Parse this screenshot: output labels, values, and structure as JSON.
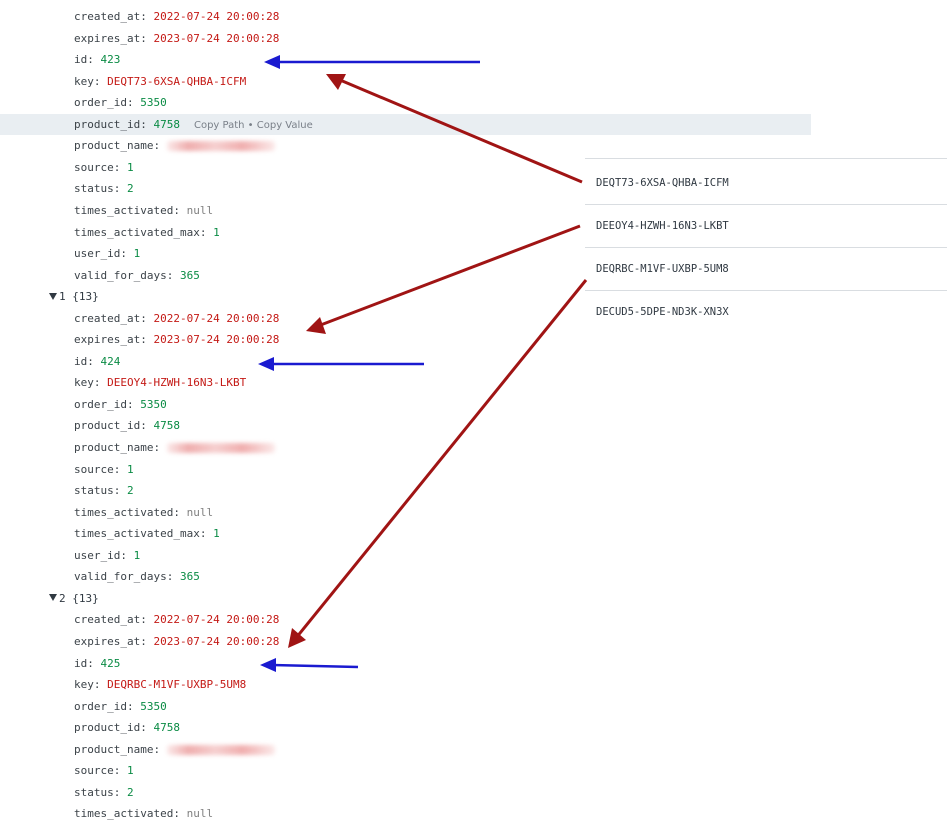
{
  "rows": [
    {
      "type": "field",
      "key": "created_at",
      "value": "2022-07-24 20:00:28",
      "vclass": "s"
    },
    {
      "type": "field",
      "key": "expires_at",
      "value": "2023-07-24 20:00:28",
      "vclass": "s"
    },
    {
      "type": "field",
      "key": "id",
      "value": "423",
      "vclass": "n"
    },
    {
      "type": "field",
      "key": "key",
      "value": "DEQT73-6XSA-QHBA-ICFM",
      "vclass": "s"
    },
    {
      "type": "field",
      "key": "order_id",
      "value": "5350",
      "vclass": "n"
    },
    {
      "type": "field",
      "key": "product_id",
      "value": "4758",
      "vclass": "n",
      "hover": true,
      "hint": "Copy Path • Copy Value"
    },
    {
      "type": "field",
      "key": "product_name",
      "value": "",
      "vclass": "blur"
    },
    {
      "type": "field",
      "key": "source",
      "value": "1",
      "vclass": "n"
    },
    {
      "type": "field",
      "key": "status",
      "value": "2",
      "vclass": "n"
    },
    {
      "type": "field",
      "key": "times_activated",
      "value": "null",
      "vclass": "nl"
    },
    {
      "type": "field",
      "key": "times_activated_max",
      "value": "1",
      "vclass": "n"
    },
    {
      "type": "field",
      "key": "user_id",
      "value": "1",
      "vclass": "n"
    },
    {
      "type": "field",
      "key": "valid_for_days",
      "value": "365",
      "vclass": "n"
    },
    {
      "type": "header",
      "index": "1",
      "count": "{13}"
    },
    {
      "type": "field",
      "key": "created_at",
      "value": "2022-07-24 20:00:28",
      "vclass": "s"
    },
    {
      "type": "field",
      "key": "expires_at",
      "value": "2023-07-24 20:00:28",
      "vclass": "s"
    },
    {
      "type": "field",
      "key": "id",
      "value": "424",
      "vclass": "n"
    },
    {
      "type": "field",
      "key": "key",
      "value": "DEEOY4-HZWH-16N3-LKBT",
      "vclass": "s"
    },
    {
      "type": "field",
      "key": "order_id",
      "value": "5350",
      "vclass": "n"
    },
    {
      "type": "field",
      "key": "product_id",
      "value": "4758",
      "vclass": "n"
    },
    {
      "type": "field",
      "key": "product_name",
      "value": "",
      "vclass": "blur"
    },
    {
      "type": "field",
      "key": "source",
      "value": "1",
      "vclass": "n"
    },
    {
      "type": "field",
      "key": "status",
      "value": "2",
      "vclass": "n"
    },
    {
      "type": "field",
      "key": "times_activated",
      "value": "null",
      "vclass": "nl"
    },
    {
      "type": "field",
      "key": "times_activated_max",
      "value": "1",
      "vclass": "n"
    },
    {
      "type": "field",
      "key": "user_id",
      "value": "1",
      "vclass": "n"
    },
    {
      "type": "field",
      "key": "valid_for_days",
      "value": "365",
      "vclass": "n"
    },
    {
      "type": "header",
      "index": "2",
      "count": "{13}"
    },
    {
      "type": "field",
      "key": "created_at",
      "value": "2022-07-24 20:00:28",
      "vclass": "s"
    },
    {
      "type": "field",
      "key": "expires_at",
      "value": "2023-07-24 20:00:28",
      "vclass": "s"
    },
    {
      "type": "field",
      "key": "id",
      "value": "425",
      "vclass": "n"
    },
    {
      "type": "field",
      "key": "key",
      "value": "DEQRBC-M1VF-UXBP-5UM8",
      "vclass": "s"
    },
    {
      "type": "field",
      "key": "order_id",
      "value": "5350",
      "vclass": "n"
    },
    {
      "type": "field",
      "key": "product_id",
      "value": "4758",
      "vclass": "n"
    },
    {
      "type": "field",
      "key": "product_name",
      "value": "",
      "vclass": "blur"
    },
    {
      "type": "field",
      "key": "source",
      "value": "1",
      "vclass": "n"
    },
    {
      "type": "field",
      "key": "status",
      "value": "2",
      "vclass": "n"
    },
    {
      "type": "field",
      "key": "times_activated",
      "value": "null",
      "vclass": "nl"
    }
  ],
  "side_list": {
    "cut_text": "· · · · · · ·",
    "items": [
      "DEQT73-6XSA-QHBA-ICFM",
      "DEEOY4-HZWH-16N3-LKBT",
      "DEQRBC-M1VF-UXBP-5UM8",
      "DECUD5-5DPE-ND3K-XN3X"
    ]
  },
  "colors": {
    "string": "#c41a16",
    "number": "#0a8b44",
    "null": "#808080",
    "arrow_red": "#b01818",
    "arrow_blue": "#1a1ad0"
  }
}
